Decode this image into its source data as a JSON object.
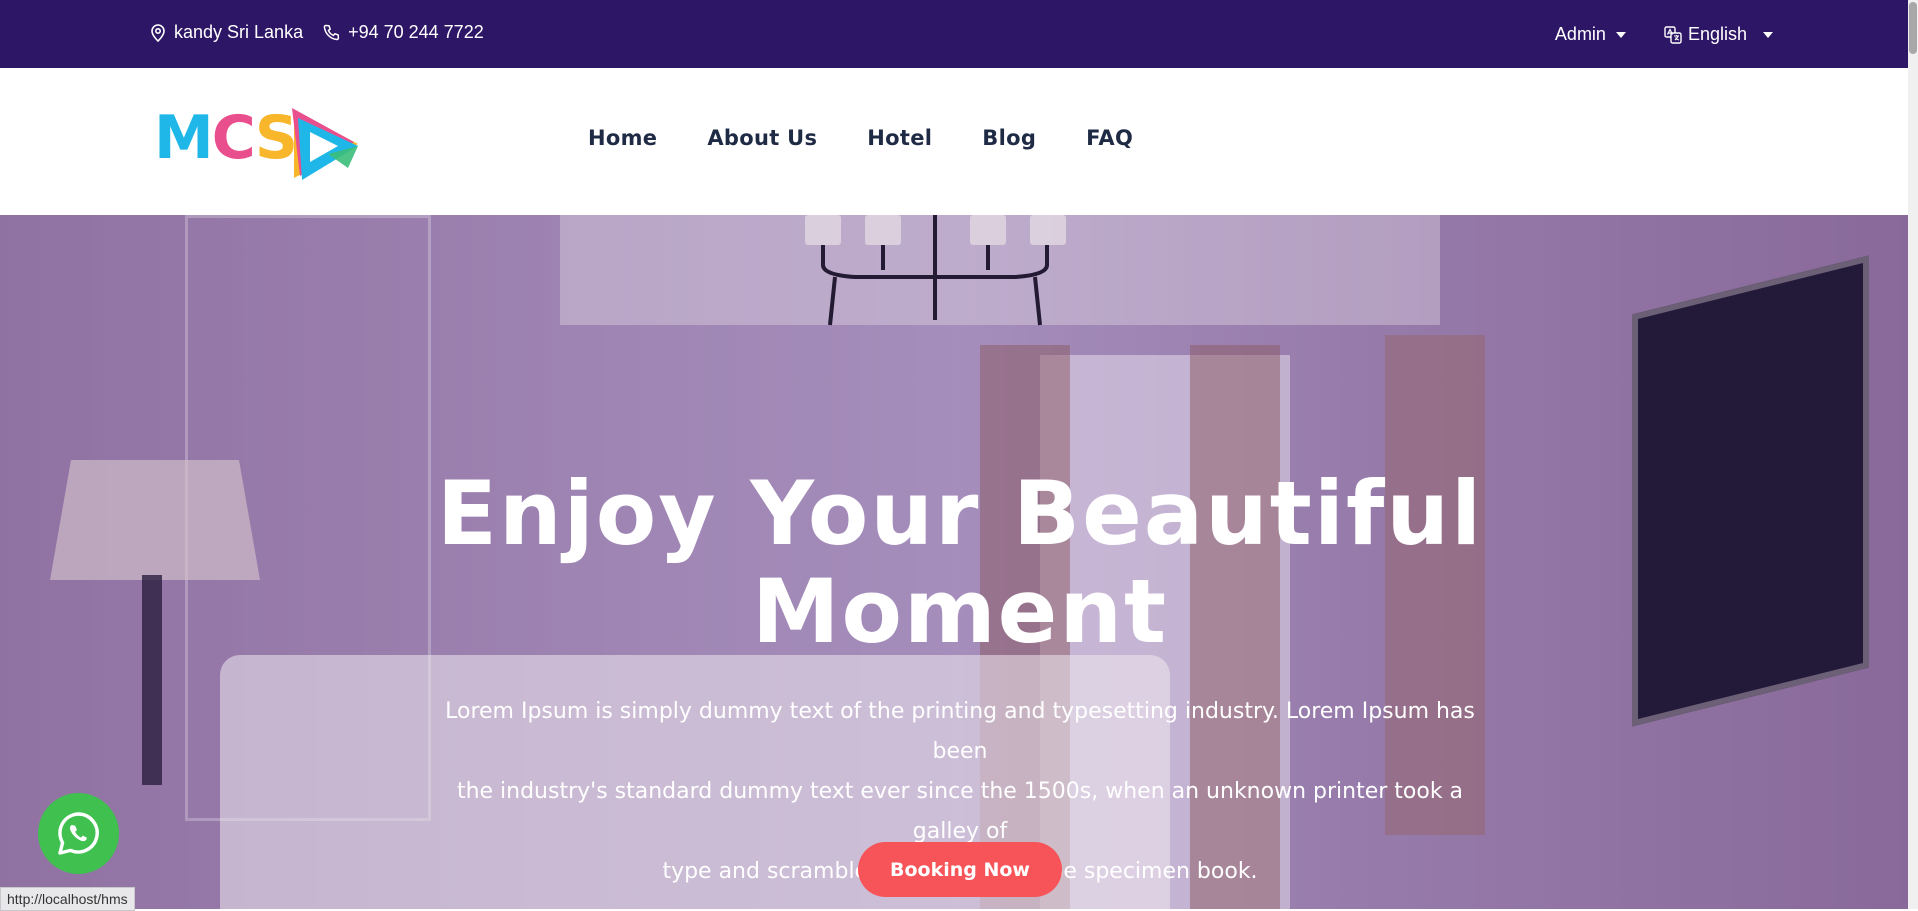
{
  "topbar": {
    "location_icon": "map-pin-icon",
    "location": "kandy Sri Lanka",
    "phone_icon": "phone-icon",
    "phone": "+94 70 244 7722",
    "admin_label": "Admin",
    "language_icon": "translate-icon",
    "language_label": "English"
  },
  "header": {
    "logo_text": "MCS",
    "nav": [
      {
        "label": "Home"
      },
      {
        "label": "About Us"
      },
      {
        "label": "Hotel"
      },
      {
        "label": "Blog"
      },
      {
        "label": "FAQ"
      }
    ]
  },
  "hero": {
    "title_line1": "Enjoy Your Beautiful",
    "title_line2": "Moment",
    "text_line1": "Lorem Ipsum is simply dummy text of the printing and typesetting industry. Lorem Ipsum has been",
    "text_line2": "the industry's standard dummy text ever since the 1500s, when an unknown printer took a galley of",
    "text_line3": "type and scrambled it to make a type specimen book.",
    "button_label": "Booking Now"
  },
  "floating": {
    "whatsapp_icon": "whatsapp-icon"
  },
  "statusbar": {
    "url": "http://localhost/hms"
  },
  "colors": {
    "topbar_bg": "#2e1666",
    "button_bg": "#f65459",
    "nav_text": "#1f2a44",
    "whatsapp": "#3fc04f"
  }
}
